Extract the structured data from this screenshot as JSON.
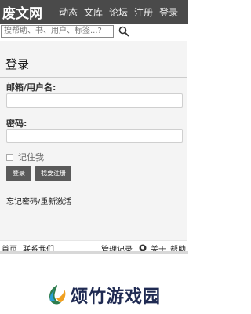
{
  "header": {
    "logo": "废文网",
    "nav": [
      "动态",
      "文库",
      "论坛",
      "注册",
      "登录"
    ]
  },
  "search": {
    "placeholder": "搜帮助、书、用户、标签...?"
  },
  "login": {
    "title": "登录",
    "email_label": "邮箱/用户名:",
    "password_label": "密码:",
    "remember_label": "记住我",
    "login_button": "登录",
    "register_button": "我要注册",
    "forgot_link": "忘记密码/重新激活"
  },
  "footer": {
    "home": "首页",
    "contact": "联系我们",
    "records": "管理记录",
    "about": "关于",
    "help": "帮助"
  },
  "watermark": {
    "text": "颂竹游戏园"
  },
  "colors": {
    "header_bg": "#4a4a4a",
    "panel_bg": "#f4f4f4",
    "button_bg": "#5a5a5a",
    "brand_text": "#1f2a52"
  }
}
